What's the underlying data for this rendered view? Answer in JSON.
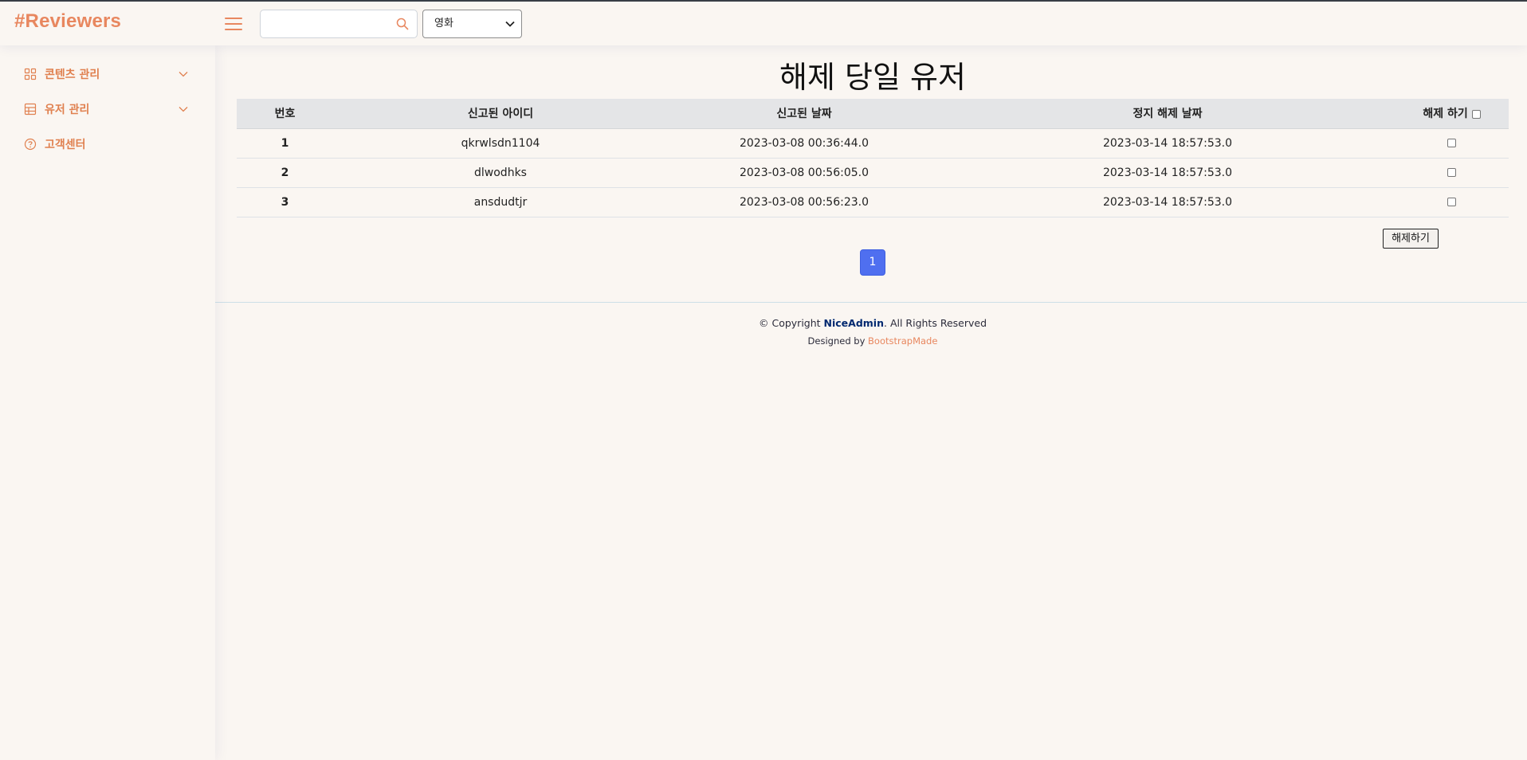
{
  "header": {
    "logo": "#Reviewers",
    "search": {
      "placeholder": "",
      "value": ""
    },
    "category_select": {
      "selected": "영화"
    }
  },
  "sidebar": {
    "items": [
      {
        "label": "콘텐츠 관리",
        "icon": "grid-icon",
        "expandable": true
      },
      {
        "label": "유저 관리",
        "icon": "layout-icon",
        "expandable": true
      },
      {
        "label": "고객센터",
        "icon": "question-circle-icon",
        "expandable": false
      }
    ]
  },
  "main": {
    "title": "해제 당일 유저",
    "table": {
      "headers": [
        "번호",
        "신고된 아이디",
        "신고된 날짜",
        "정지 해제 날짜",
        "해제 하기"
      ],
      "rows": [
        {
          "no": "1",
          "id": "qkrwlsdn1104",
          "reported": "2023-03-08 00:36:44.0",
          "release": "2023-03-14 18:57:53.0"
        },
        {
          "no": "2",
          "id": "dlwodhks",
          "reported": "2023-03-08 00:56:05.0",
          "release": "2023-03-14 18:57:53.0"
        },
        {
          "no": "3",
          "id": "ansdudtjr",
          "reported": "2023-03-08 00:56:23.0",
          "release": "2023-03-14 18:57:53.0"
        }
      ]
    },
    "release_button": "해제하기",
    "pagination": {
      "current": "1"
    }
  },
  "footer": {
    "copyright_prefix": "© Copyright ",
    "brand": "NiceAdmin",
    "copyright_suffix": ". All Rights Reserved",
    "designed_by": "Designed by ",
    "designer": "BootstrapMade"
  },
  "colors": {
    "accent": "#e8875f",
    "background": "#faf6f2",
    "page_active": "#4f6ff0",
    "table_header": "#e4e5e7"
  }
}
